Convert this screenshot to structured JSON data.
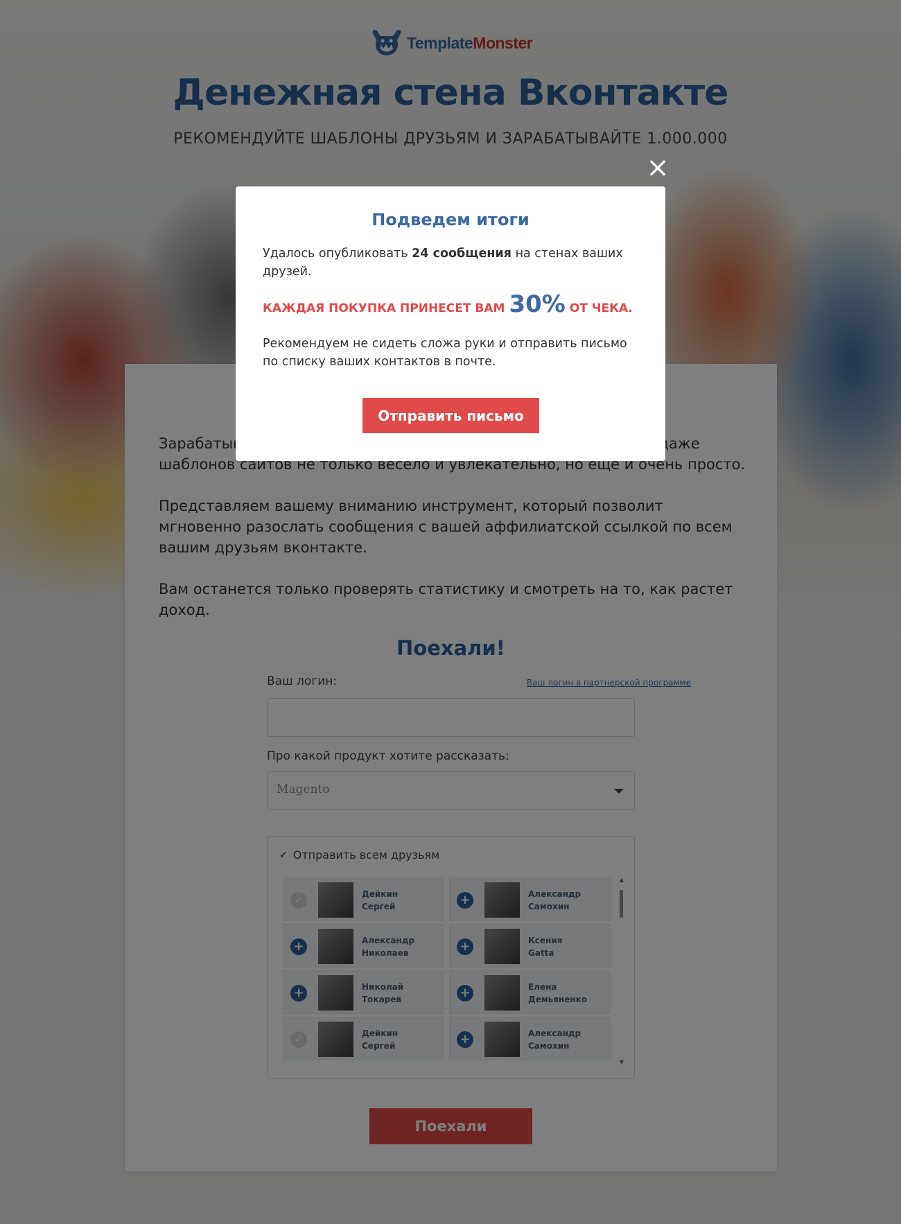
{
  "header": {
    "logo_part1": "Template",
    "logo_part2": "Monster",
    "title": "Денежная стена Вконтакте",
    "subtitle": "РЕКОМЕНДУЙТЕ ШАБЛОНЫ ДРУЗЬЯМ И ЗАРАБАТЫВАЙТЕ 1.000.000"
  },
  "intro": {
    "p1": "Зарабатывать на партнерской программе TemplateMonster в продаже шаблонов сайтов не только весело и увлекательно, но еще и очень просто.",
    "p2": "Представляем вашему вниманию инструмент, который позволит мгновенно разослать сообщения с вашей аффилиатской ссылкой по всем вашим друзьям вконтакте.",
    "p3": "Вам останется только проверять статистику и смотреть на то, как растет доход."
  },
  "form": {
    "heading": "Поехали!",
    "login_label": "Ваш логин:",
    "login_help": "Ваш логин в партнерской программе",
    "login_value": "",
    "product_label": "Про какой продукт хотите рассказать:",
    "product_selected": "Magento",
    "send_all_label": "Отправить всем друзьям",
    "submit_label": "Поехали",
    "friends": [
      {
        "first": "Дейкин",
        "last": "Сергей",
        "state": "done"
      },
      {
        "first": "Александр",
        "last": "Самохин",
        "state": "add"
      },
      {
        "first": "Александр",
        "last": "Николаев",
        "state": "add"
      },
      {
        "first": "Ксения",
        "last": "Gatta",
        "state": "add"
      },
      {
        "first": "Николай",
        "last": "Токарев",
        "state": "add"
      },
      {
        "first": "Елена",
        "last": "Демьяненко",
        "state": "add"
      },
      {
        "first": "Дейкин",
        "last": "Сергей",
        "state": "done"
      },
      {
        "first": "Александр",
        "last": "Самохин",
        "state": "add"
      }
    ]
  },
  "modal": {
    "close_symbol": "×",
    "title": "Подведем итоги",
    "p1_prefix": "Удалось опубликовать ",
    "p1_bold": "24 сообщения",
    "p1_suffix": " на стенах ваших друзей.",
    "p2_prefix": "КАЖДАЯ ПОКУПКА ПРИНЕСЕТ ВАМ",
    "p2_percent": "30%",
    "p2_suffix": "ОТ ЧЕКА.",
    "p3": "Рекомендуем не сидеть сложа руки и отправить письмо по списку ваших контактов в почте.",
    "button_label": "Отправить письмо"
  },
  "colors": {
    "brand_blue": "#2e5e96",
    "accent_red": "#e04a4a"
  }
}
